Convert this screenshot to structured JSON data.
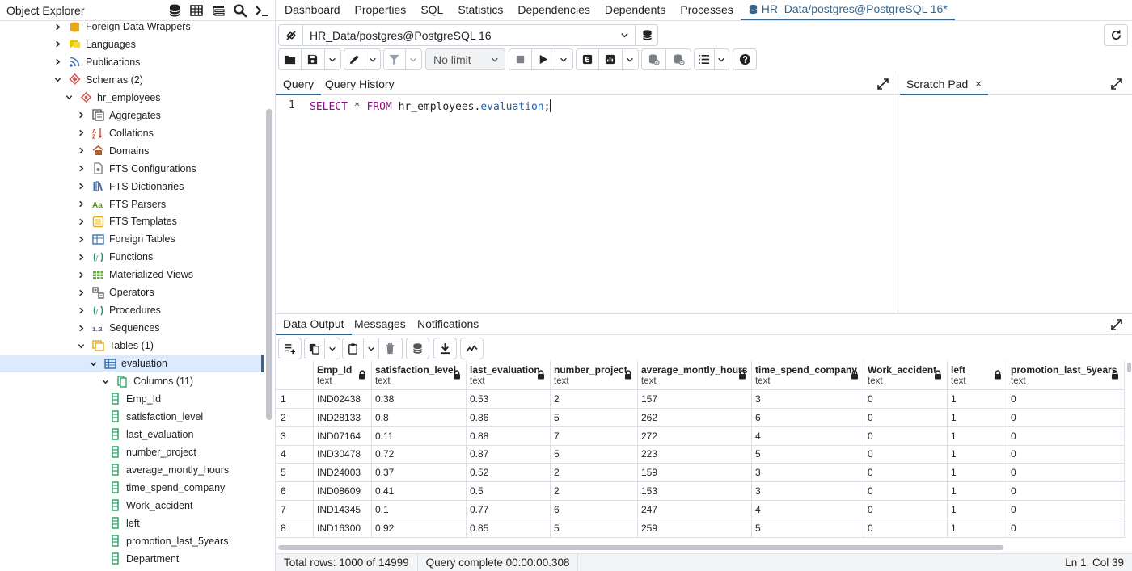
{
  "object_explorer": {
    "title": "Object Explorer",
    "tools": [
      "database-icon",
      "table-icon",
      "hierarchy-icon",
      "search-icon",
      "terminal-icon"
    ]
  },
  "tree": [
    {
      "label": "Foreign Data Wrappers",
      "indent": 1,
      "chev": "right",
      "icon": "foreign-data-wrapper-icon",
      "color": "#e6a817"
    },
    {
      "label": "Languages",
      "indent": 1,
      "chev": "right",
      "icon": "language-icon",
      "color": "#e6c700"
    },
    {
      "label": "Publications",
      "indent": 1,
      "chev": "right",
      "icon": "publication-icon",
      "color": "#3d72b4"
    },
    {
      "label": "Schemas (2)",
      "indent": 1,
      "chev": "down",
      "icon": "schemas-icon",
      "color": "#d9534f"
    },
    {
      "label": "hr_employees",
      "indent": 2,
      "chev": "down",
      "icon": "schema-icon",
      "color": "#d9534f"
    },
    {
      "label": "Aggregates",
      "indent": 3,
      "chev": "right",
      "icon": "aggregate-icon",
      "color": "#555"
    },
    {
      "label": "Collations",
      "indent": 3,
      "chev": "right",
      "icon": "collation-icon",
      "color": "#c0392b"
    },
    {
      "label": "Domains",
      "indent": 3,
      "chev": "right",
      "icon": "domain-icon",
      "color": "#b05a2a"
    },
    {
      "label": "FTS Configurations",
      "indent": 3,
      "chev": "right",
      "icon": "fts-configuration-icon",
      "color": "#777"
    },
    {
      "label": "FTS Dictionaries",
      "indent": 3,
      "chev": "right",
      "icon": "fts-dictionary-icon",
      "color": "#3d72b4"
    },
    {
      "label": "FTS Parsers",
      "indent": 3,
      "chev": "right",
      "icon": "fts-parser-icon",
      "color": "#5a8a2a"
    },
    {
      "label": "FTS Templates",
      "indent": 3,
      "chev": "right",
      "icon": "fts-template-icon",
      "color": "#e6a817"
    },
    {
      "label": "Foreign Tables",
      "indent": 3,
      "chev": "right",
      "icon": "foreign-table-icon",
      "color": "#3d72b4"
    },
    {
      "label": "Functions",
      "indent": 3,
      "chev": "right",
      "icon": "function-icon",
      "color": "#2a8a6a"
    },
    {
      "label": "Materialized Views",
      "indent": 3,
      "chev": "right",
      "icon": "materialized-view-icon",
      "color": "#6aa83a"
    },
    {
      "label": "Operators",
      "indent": 3,
      "chev": "right",
      "icon": "operator-icon",
      "color": "#555"
    },
    {
      "label": "Procedures",
      "indent": 3,
      "chev": "right",
      "icon": "procedure-icon",
      "color": "#2a8a6a"
    },
    {
      "label": "Sequences",
      "indent": 3,
      "chev": "right",
      "icon": "sequence-icon",
      "color": "#7a3ab4"
    },
    {
      "label": "Tables (1)",
      "indent": 3,
      "chev": "down",
      "icon": "tables-icon",
      "color": "#e6a817"
    },
    {
      "label": "evaluation",
      "indent": 4,
      "chev": "down",
      "icon": "table-icon",
      "color": "#3d72b4",
      "selected": true
    },
    {
      "label": "Columns (11)",
      "indent": 5,
      "chev": "down",
      "icon": "columns-icon",
      "color": "#2aa86a"
    },
    {
      "label": "Emp_Id",
      "indent": 6,
      "chev": "none",
      "icon": "column-icon",
      "color": "#2aa86a"
    },
    {
      "label": "satisfaction_level",
      "indent": 6,
      "chev": "none",
      "icon": "column-icon",
      "color": "#2aa86a"
    },
    {
      "label": "last_evaluation",
      "indent": 6,
      "chev": "none",
      "icon": "column-icon",
      "color": "#2aa86a"
    },
    {
      "label": "number_project",
      "indent": 6,
      "chev": "none",
      "icon": "column-icon",
      "color": "#2aa86a"
    },
    {
      "label": "average_montly_hours",
      "indent": 6,
      "chev": "none",
      "icon": "column-icon",
      "color": "#2aa86a"
    },
    {
      "label": "time_spend_company",
      "indent": 6,
      "chev": "none",
      "icon": "column-icon",
      "color": "#2aa86a"
    },
    {
      "label": "Work_accident",
      "indent": 6,
      "chev": "none",
      "icon": "column-icon",
      "color": "#2aa86a"
    },
    {
      "label": "left",
      "indent": 6,
      "chev": "none",
      "icon": "column-icon",
      "color": "#2aa86a"
    },
    {
      "label": "promotion_last_5years",
      "indent": 6,
      "chev": "none",
      "icon": "column-icon",
      "color": "#2aa86a"
    },
    {
      "label": "Department",
      "indent": 6,
      "chev": "none",
      "icon": "column-icon",
      "color": "#2aa86a"
    }
  ],
  "main_tabs": [
    {
      "label": "Dashboard"
    },
    {
      "label": "Properties"
    },
    {
      "label": "SQL"
    },
    {
      "label": "Statistics"
    },
    {
      "label": "Dependencies"
    },
    {
      "label": "Dependents"
    },
    {
      "label": "Processes"
    },
    {
      "label": "HR_Data/postgres@PostgreSQL 16*",
      "active": true
    }
  ],
  "connection": {
    "value": "HR_Data/postgres@PostgreSQL 16"
  },
  "toolbar": {
    "limit_value": "No limit"
  },
  "query_tabs": {
    "query": "Query",
    "history": "Query History",
    "scratch": "Scratch Pad",
    "scratch_close": "×"
  },
  "editor": {
    "line_number": "1",
    "kw_select": "SELECT",
    "star": " * ",
    "kw_from": "FROM",
    "schema": " hr_employees.",
    "table": "evaluation",
    "semicolon": ";"
  },
  "output_tabs": {
    "data_output": "Data Output",
    "messages": "Messages",
    "notifications": "Notifications"
  },
  "grid": {
    "columns": [
      {
        "name": "Emp_Id",
        "type": "text"
      },
      {
        "name": "satisfaction_level",
        "type": "text"
      },
      {
        "name": "last_evaluation",
        "type": "text"
      },
      {
        "name": "number_project",
        "type": "text"
      },
      {
        "name": "average_montly_hours",
        "type": "text"
      },
      {
        "name": "time_spend_company",
        "type": "text"
      },
      {
        "name": "Work_accident",
        "type": "text"
      },
      {
        "name": "left",
        "type": "text"
      },
      {
        "name": "promotion_last_5years",
        "type": "text"
      }
    ],
    "rows": [
      [
        "1",
        "IND02438",
        "0.38",
        "0.53",
        "2",
        "157",
        "3",
        "0",
        "1",
        "0"
      ],
      [
        "2",
        "IND28133",
        "0.8",
        "0.86",
        "5",
        "262",
        "6",
        "0",
        "1",
        "0"
      ],
      [
        "3",
        "IND07164",
        "0.11",
        "0.88",
        "7",
        "272",
        "4",
        "0",
        "1",
        "0"
      ],
      [
        "4",
        "IND30478",
        "0.72",
        "0.87",
        "5",
        "223",
        "5",
        "0",
        "1",
        "0"
      ],
      [
        "5",
        "IND24003",
        "0.37",
        "0.52",
        "2",
        "159",
        "3",
        "0",
        "1",
        "0"
      ],
      [
        "6",
        "IND08609",
        "0.41",
        "0.5",
        "2",
        "153",
        "3",
        "0",
        "1",
        "0"
      ],
      [
        "7",
        "IND14345",
        "0.1",
        "0.77",
        "6",
        "247",
        "4",
        "0",
        "1",
        "0"
      ],
      [
        "8",
        "IND16300",
        "0.92",
        "0.85",
        "5",
        "259",
        "5",
        "0",
        "1",
        "0"
      ]
    ]
  },
  "status": {
    "total_rows": "Total rows: 1000 of 14999",
    "query_status": "Query complete 00:00:00.308",
    "cursor_pos": "Ln 1, Col 39"
  },
  "colors": {
    "accent": "#326690",
    "selection": "#dbeafd",
    "sql_keyword": "#8b0f7e",
    "sql_field": "#1f5fa8"
  }
}
